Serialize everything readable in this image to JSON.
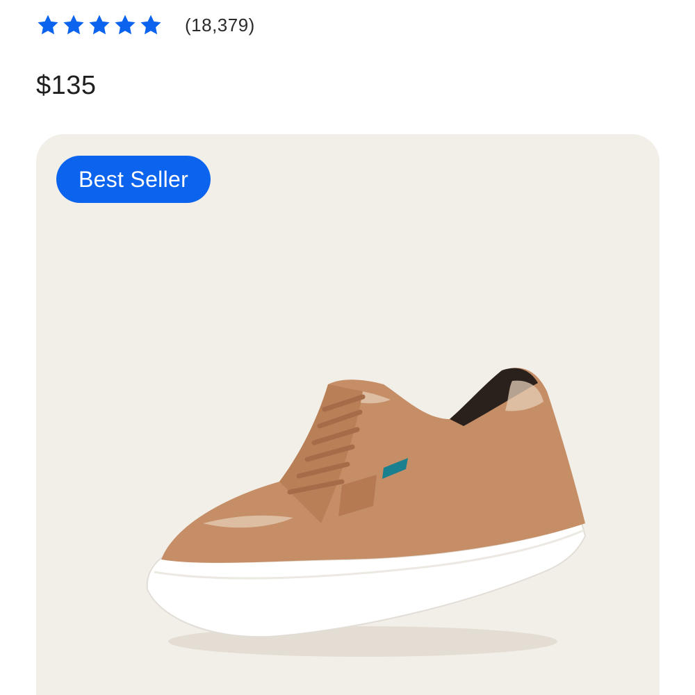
{
  "rating": {
    "stars": 5,
    "star_color": "#0b63ee",
    "review_count": "(18,379)"
  },
  "price": "$135",
  "product": {
    "badge": "Best Seller",
    "badge_color": "#0b63ee",
    "card_background": "#f2eee8",
    "image_icon": "tan-knit-sneaker-image"
  }
}
